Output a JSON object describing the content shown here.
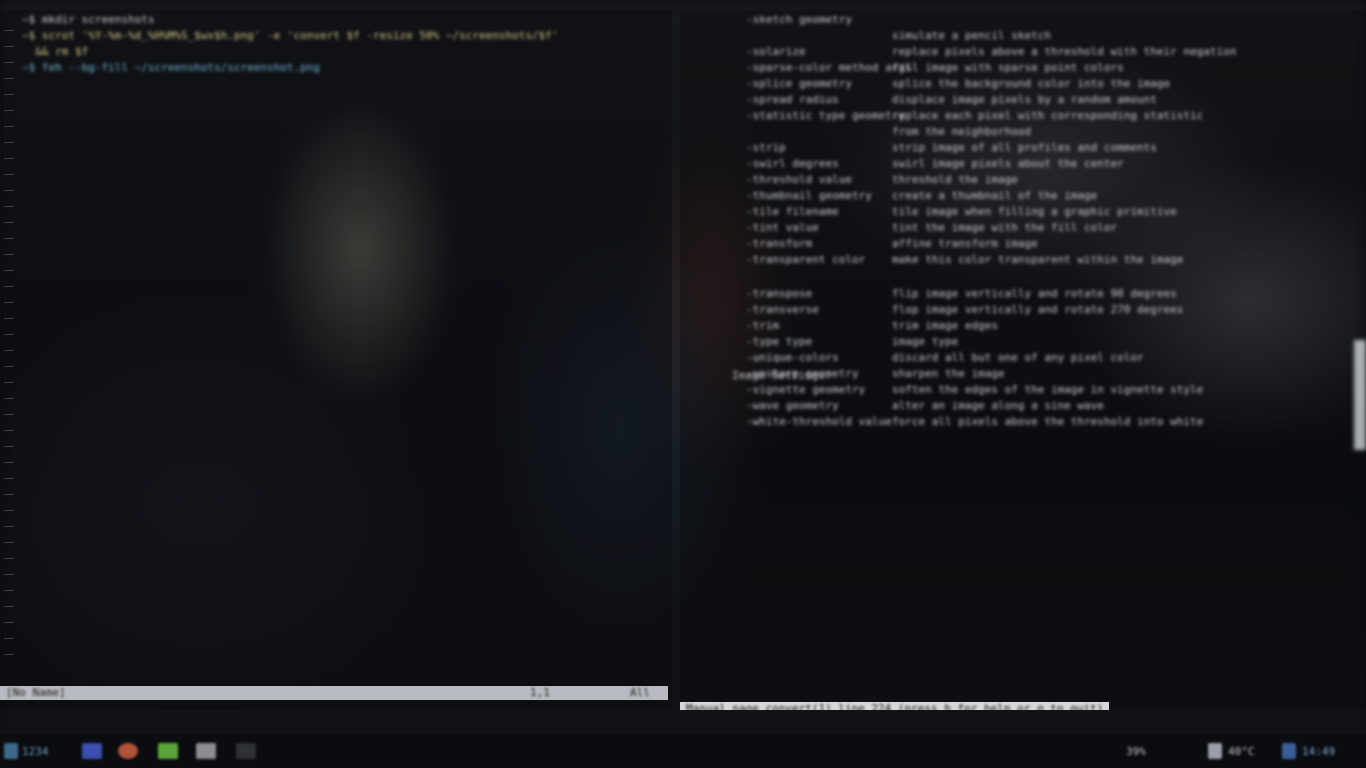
{
  "colors": {
    "background": "#0b0d10",
    "statusline_bg": "#b8bcc2",
    "man_status_bg": "#d8d8d8",
    "accent_blue": "#6fb8d6",
    "taskbar_bg": "#0a0c0f"
  },
  "left_pane": {
    "lines": [
      {
        "text": "~$ mkdir screenshots"
      },
      {
        "text": "~$ scrot '%Y-%m-%d_%H%M%S_$wx$h.png' -e 'convert $f -resize 50% ~/screenshots/$f'"
      },
      {
        "text": "  && rm $f"
      },
      {
        "text": "~$ feh --bg-fill ~/screenshots/screenshot.png"
      }
    ],
    "status": {
      "file": "[No Name]",
      "position": "1,1",
      "scroll": "All"
    }
  },
  "right_pane": {
    "lines": [
      {
        "opt": "-sketch geometry",
        "desc": ""
      },
      {
        "opt": "",
        "desc": "simulate a pencil sketch"
      },
      {
        "opt": "-solarize",
        "desc": "replace pixels above a threshold with their negation"
      },
      {
        "opt": "-sparse-color method args",
        "desc": "fill image with sparse point colors"
      },
      {
        "opt": "-splice geometry",
        "desc": "splice the background color into the image"
      },
      {
        "opt": "-spread radius",
        "desc": "displace image pixels by a random amount"
      },
      {
        "opt": "-statistic type geometry",
        "desc": "replace each pixel with corresponding statistic"
      },
      {
        "opt": "",
        "desc": "from the neighborhood"
      },
      {
        "opt": "-strip",
        "desc": "strip image of all profiles and comments"
      },
      {
        "opt": "-swirl degrees",
        "desc": "swirl image pixels about the center"
      },
      {
        "opt": "-threshold value",
        "desc": "threshold the image"
      },
      {
        "opt": "-thumbnail geometry",
        "desc": "create a thumbnail of the image"
      },
      {
        "opt": "-tile filename",
        "desc": "tile image when filling a graphic primitive"
      },
      {
        "opt": "-tint value",
        "desc": "tint the image with the fill color"
      },
      {
        "opt": "-transform",
        "desc": "affine transform image"
      },
      {
        "opt": "-transparent color",
        "desc": "make this color transparent within the image"
      },
      {
        "opt": "-transpose",
        "desc": "flip image vertically and rotate 90 degrees"
      },
      {
        "opt": "-transverse",
        "desc": "flop image vertically and rotate 270 degrees"
      },
      {
        "opt": "-trim",
        "desc": "trim image edges"
      },
      {
        "opt": "-type type",
        "desc": "image type"
      },
      {
        "opt": "-unique-colors",
        "desc": "discard all but one of any pixel color"
      },
      {
        "opt": "-unsharp geometry",
        "desc": "sharpen the image"
      },
      {
        "opt": "-vignette geometry",
        "desc": "soften the edges of the image in vignette style"
      },
      {
        "opt": "-wave geometry",
        "desc": "alter an image along a sine wave"
      },
      {
        "opt": "-white-threshold value",
        "desc": "force all pixels above the threshold into white"
      }
    ],
    "section_header": "Image Settings:",
    "status": "Manual page convert(1) line 224 (press h for help or q to quit)"
  },
  "taskbar": {
    "workspace": "1234",
    "right_items": [
      {
        "label": "39%"
      },
      {
        "label": "40°C"
      },
      {
        "label": "14:49"
      }
    ]
  }
}
